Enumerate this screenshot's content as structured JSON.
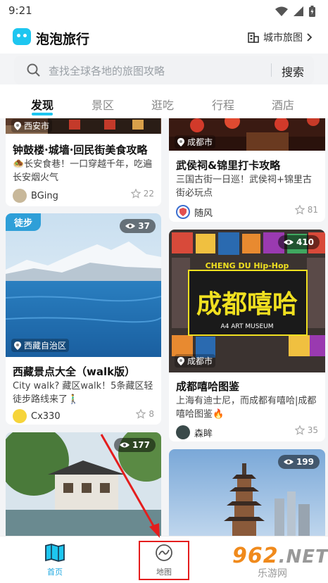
{
  "status": {
    "time": "9:21"
  },
  "app": {
    "title": "泡泡旅行",
    "city_map_label": "城市旅图"
  },
  "search": {
    "placeholder": "查找全球各地的旅图攻略",
    "button": "搜索"
  },
  "tabs": [
    {
      "label": "发现",
      "active": true
    },
    {
      "label": "景区",
      "active": false
    },
    {
      "label": "逛吃",
      "active": false
    },
    {
      "label": "行程",
      "active": false
    },
    {
      "label": "酒店",
      "active": false
    }
  ],
  "cards": [
    {
      "location": "西安市",
      "title": "钟鼓楼·城墙·回民街美食攻略",
      "desc": "🧆长安食巷！一口穿越千年，吃遍长安烟火气",
      "user": "BGing",
      "likes": "22"
    },
    {
      "location": "成都市",
      "title": "武侯祠&锦里打卡攻略",
      "desc": "三国古街一日巡！武侯祠+锦里古街必玩点",
      "user": "随风",
      "likes": "81"
    },
    {
      "tag": "徒步",
      "views": "37",
      "location": "西藏自治区",
      "title": "西藏景点大全（walk版）",
      "desc": "City walk? 藏区walk！5条藏区轻徒步路线来了🚶‍♂️",
      "user": "Cx330",
      "likes": "8"
    },
    {
      "views": "410",
      "location": "成都市",
      "title": "成都嘻哈图鉴",
      "desc": "上海有迪士尼，而成都有嘻哈|成都嘻哈图鉴🔥",
      "user": "森眸",
      "likes": "35",
      "img_text": "成都嘻哈",
      "img_sub": "A4 ART MUSEUM",
      "img_top": "CHENG DU Hip-Hop"
    },
    {
      "views": "177"
    },
    {
      "views": "199"
    }
  ],
  "bottom_nav": [
    {
      "label": "首页",
      "active": true
    },
    {
      "label": "地图",
      "active": false
    }
  ],
  "watermark": {
    "number": "962",
    "suffix": ".NET",
    "site": "乐游网"
  },
  "colors": {
    "accent": "#1ec6f0",
    "highlight": "#e41d1d",
    "tag": "#2f9fd8"
  }
}
